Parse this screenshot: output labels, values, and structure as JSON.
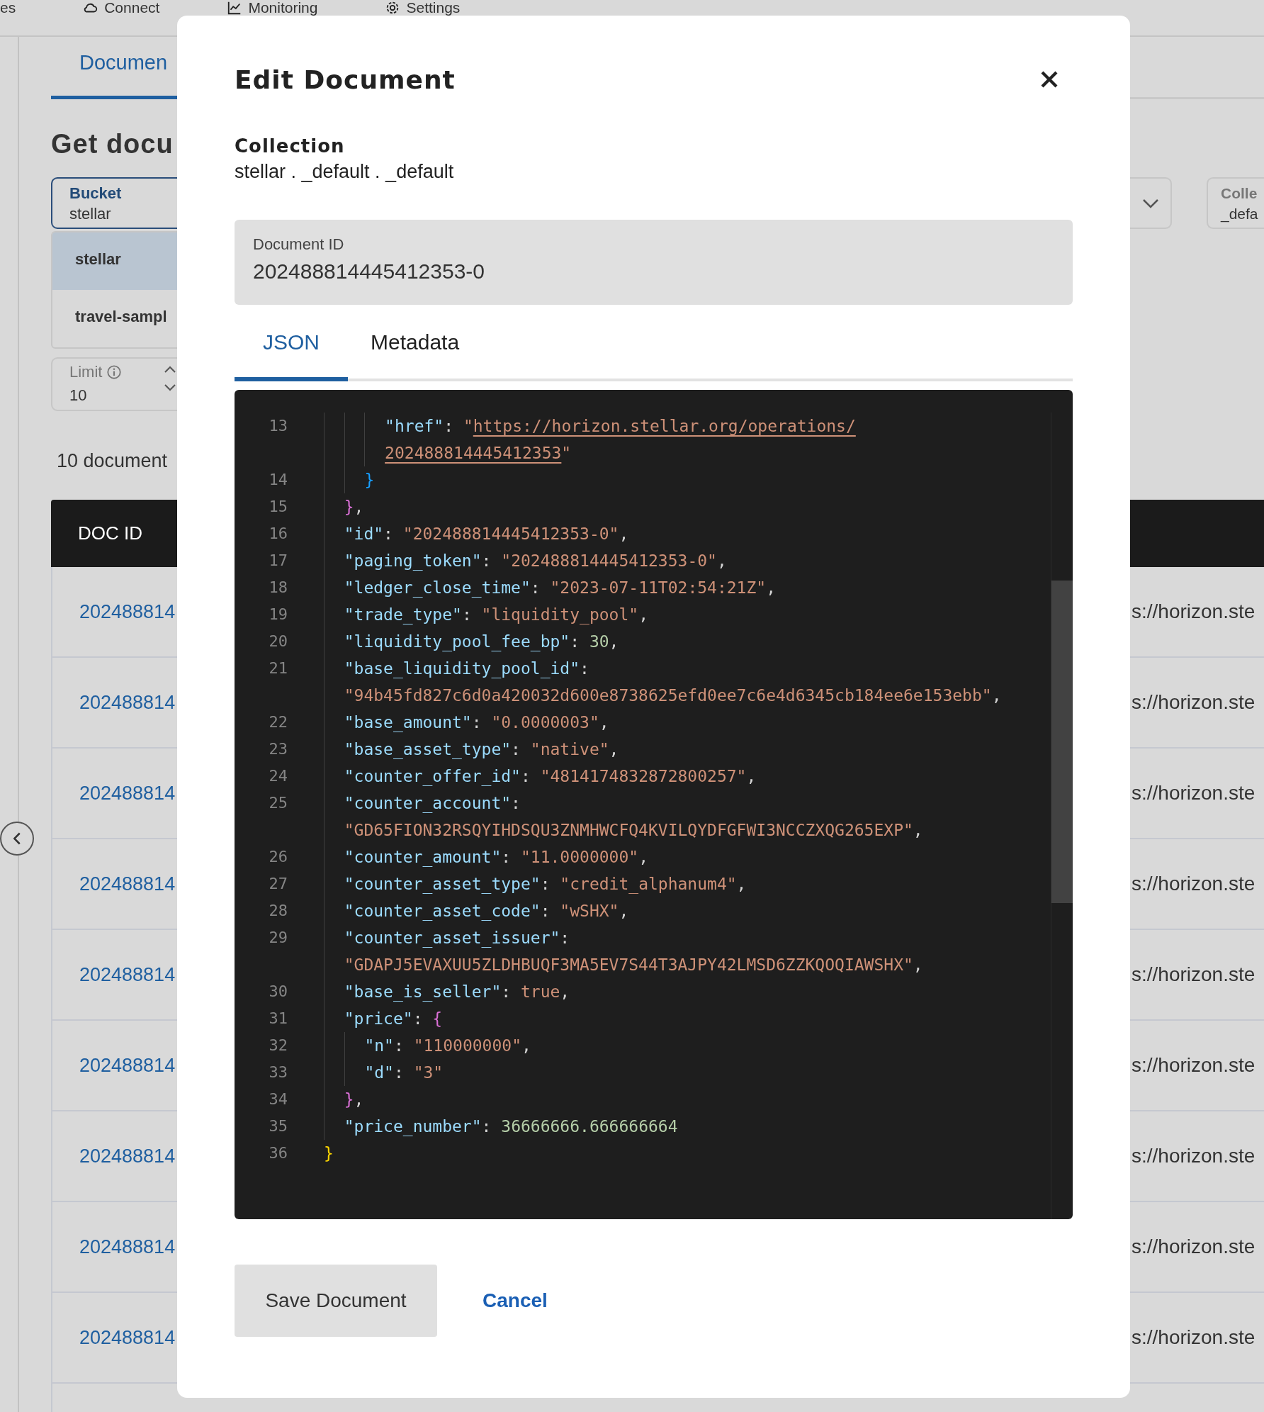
{
  "background": {
    "nav_items": [
      {
        "label": "es",
        "kind": "plain"
      },
      {
        "label": "Connect",
        "kind": "connect"
      },
      {
        "label": "Monitoring",
        "kind": "monitoring"
      },
      {
        "label": "Settings",
        "kind": "settings"
      }
    ],
    "tab": {
      "label": "Documen",
      "selected": true
    },
    "heading": "Get docu",
    "bucket_field": {
      "label": "Bucket",
      "value": "stellar"
    },
    "bucket_options": [
      {
        "label": "stellar",
        "selected": true
      },
      {
        "label": "travel-sampl",
        "selected": false
      }
    ],
    "limit_field": {
      "label": "Limit",
      "value": "10"
    },
    "collection_field": {
      "label": "Colle",
      "value": "_defa"
    },
    "result_count": "10 document",
    "table": {
      "columns": [
        "DOC ID"
      ],
      "rows": [
        {
          "doc_id": "202488814",
          "column_2": "s://horizon.ste"
        },
        {
          "doc_id": "202488814",
          "column_2": "s://horizon.ste"
        },
        {
          "doc_id": "202488814",
          "column_2": "s://horizon.ste"
        },
        {
          "doc_id": "202488814",
          "column_2": "s://horizon.ste"
        },
        {
          "doc_id": "202488814",
          "column_2": "s://horizon.ste"
        },
        {
          "doc_id": "202488814",
          "column_2": "s://horizon.ste"
        },
        {
          "doc_id": "202488814",
          "column_2": "s://horizon.ste"
        },
        {
          "doc_id": "202488814",
          "column_2": "s://horizon.ste"
        },
        {
          "doc_id": "202488814",
          "column_2": "s://horizon.ste"
        }
      ]
    }
  },
  "modal": {
    "title": "Edit Document",
    "collection_label": "Collection",
    "collection_path": "stellar . _default . _default",
    "document_id": {
      "label": "Document ID",
      "value": "202488814445412353-0"
    },
    "tabs": [
      {
        "label": "JSON",
        "selected": true
      },
      {
        "label": "Metadata",
        "selected": false
      }
    ],
    "code_rows": [
      {
        "number": "13",
        "tokens": [
          {
            "kind": "key",
            "text": "      \"href\""
          },
          {
            "kind": "punct",
            "text": ": "
          },
          {
            "kind": "string",
            "text": "\""
          },
          {
            "kind": "link",
            "text": "https://horizon.stellar.org/operations/"
          }
        ]
      },
      {
        "tokens": [
          {
            "kind": "link",
            "text": "      202488814445412353"
          },
          {
            "kind": "string",
            "text": "\""
          }
        ]
      },
      {
        "number": "14",
        "tokens": [
          {
            "kind": "brace-l3",
            "text": "    }"
          }
        ]
      },
      {
        "number": "15",
        "tokens": [
          {
            "kind": "brace-l2",
            "text": "  }"
          },
          {
            "kind": "punct",
            "text": ","
          }
        ]
      },
      {
        "number": "16",
        "tokens": [
          {
            "kind": "key",
            "text": "  \"id\""
          },
          {
            "kind": "punct",
            "text": ": "
          },
          {
            "kind": "string",
            "text": "\"202488814445412353-0\""
          },
          {
            "kind": "punct",
            "text": ","
          }
        ]
      },
      {
        "number": "17",
        "tokens": [
          {
            "kind": "key",
            "text": "  \"paging_token\""
          },
          {
            "kind": "punct",
            "text": ": "
          },
          {
            "kind": "string",
            "text": "\"202488814445412353-0\""
          },
          {
            "kind": "punct",
            "text": ","
          }
        ]
      },
      {
        "number": "18",
        "tokens": [
          {
            "kind": "key",
            "text": "  \"ledger_close_time\""
          },
          {
            "kind": "punct",
            "text": ": "
          },
          {
            "kind": "string",
            "text": "\"2023-07-11T02:54:21Z\""
          },
          {
            "kind": "punct",
            "text": ","
          }
        ]
      },
      {
        "number": "19",
        "tokens": [
          {
            "kind": "key",
            "text": "  \"trade_type\""
          },
          {
            "kind": "punct",
            "text": ": "
          },
          {
            "kind": "string",
            "text": "\"liquidity_pool\""
          },
          {
            "kind": "punct",
            "text": ","
          }
        ]
      },
      {
        "number": "20",
        "tokens": [
          {
            "kind": "key",
            "text": "  \"liquidity_pool_fee_bp\""
          },
          {
            "kind": "punct",
            "text": ": "
          },
          {
            "kind": "number",
            "text": "30"
          },
          {
            "kind": "punct",
            "text": ","
          }
        ]
      },
      {
        "number": "21",
        "tokens": [
          {
            "kind": "key",
            "text": "  \"base_liquidity_pool_id\""
          },
          {
            "kind": "punct",
            "text": ":"
          }
        ]
      },
      {
        "tokens": [
          {
            "kind": "string",
            "text": "  \"94b45fd827c6d0a420032d600e8738625efd0ee7c6e4d6345cb184ee6e153ebb\""
          },
          {
            "kind": "punct",
            "text": ","
          }
        ]
      },
      {
        "number": "22",
        "tokens": [
          {
            "kind": "key",
            "text": "  \"base_amount\""
          },
          {
            "kind": "punct",
            "text": ": "
          },
          {
            "kind": "string",
            "text": "\"0.0000003\""
          },
          {
            "kind": "punct",
            "text": ","
          }
        ]
      },
      {
        "number": "23",
        "tokens": [
          {
            "kind": "key",
            "text": "  \"base_asset_type\""
          },
          {
            "kind": "punct",
            "text": ": "
          },
          {
            "kind": "string",
            "text": "\"native\""
          },
          {
            "kind": "punct",
            "text": ","
          }
        ]
      },
      {
        "number": "24",
        "tokens": [
          {
            "kind": "key",
            "text": "  \"counter_offer_id\""
          },
          {
            "kind": "punct",
            "text": ": "
          },
          {
            "kind": "string",
            "text": "\"4814174832872800257\""
          },
          {
            "kind": "punct",
            "text": ","
          }
        ]
      },
      {
        "number": "25",
        "tokens": [
          {
            "kind": "key",
            "text": "  \"counter_account\""
          },
          {
            "kind": "punct",
            "text": ":"
          }
        ]
      },
      {
        "tokens": [
          {
            "kind": "string",
            "text": "  \"GD65FION32RSQYIHDSQU3ZNMHWCFQ4KVILQYDFGFWI3NCCZXQG265EXP\""
          },
          {
            "kind": "punct",
            "text": ","
          }
        ]
      },
      {
        "number": "26",
        "tokens": [
          {
            "kind": "key",
            "text": "  \"counter_amount\""
          },
          {
            "kind": "punct",
            "text": ": "
          },
          {
            "kind": "string",
            "text": "\"11.0000000\""
          },
          {
            "kind": "punct",
            "text": ","
          }
        ]
      },
      {
        "number": "27",
        "tokens": [
          {
            "kind": "key",
            "text": "  \"counter_asset_type\""
          },
          {
            "kind": "punct",
            "text": ": "
          },
          {
            "kind": "string",
            "text": "\"credit_alphanum4\""
          },
          {
            "kind": "punct",
            "text": ","
          }
        ]
      },
      {
        "number": "28",
        "tokens": [
          {
            "kind": "key",
            "text": "  \"counter_asset_code\""
          },
          {
            "kind": "punct",
            "text": ": "
          },
          {
            "kind": "string",
            "text": "\"wSHX\""
          },
          {
            "kind": "punct",
            "text": ","
          }
        ]
      },
      {
        "number": "29",
        "tokens": [
          {
            "kind": "key",
            "text": "  \"counter_asset_issuer\""
          },
          {
            "kind": "punct",
            "text": ":"
          }
        ]
      },
      {
        "tokens": [
          {
            "kind": "string",
            "text": "  \"GDAPJ5EVAXUU5ZLDHBUQF3MA5EV7S44T3AJPY42LMSD6ZZKQOQIAWSHX\""
          },
          {
            "kind": "punct",
            "text": ","
          }
        ]
      },
      {
        "number": "30",
        "tokens": [
          {
            "kind": "key",
            "text": "  \"base_is_seller\""
          },
          {
            "kind": "punct",
            "text": ": "
          },
          {
            "kind": "bool",
            "text": "true"
          },
          {
            "kind": "punct",
            "text": ","
          }
        ]
      },
      {
        "number": "31",
        "tokens": [
          {
            "kind": "key",
            "text": "  \"price\""
          },
          {
            "kind": "punct",
            "text": ": "
          },
          {
            "kind": "brace-l2",
            "text": "{"
          }
        ]
      },
      {
        "number": "32",
        "tokens": [
          {
            "kind": "key",
            "text": "    \"n\""
          },
          {
            "kind": "punct",
            "text": ": "
          },
          {
            "kind": "string",
            "text": "\"110000000\""
          },
          {
            "kind": "punct",
            "text": ","
          }
        ]
      },
      {
        "number": "33",
        "tokens": [
          {
            "kind": "key",
            "text": "    \"d\""
          },
          {
            "kind": "punct",
            "text": ": "
          },
          {
            "kind": "string",
            "text": "\"3\""
          }
        ]
      },
      {
        "number": "34",
        "tokens": [
          {
            "kind": "brace-l2",
            "text": "  }"
          },
          {
            "kind": "punct",
            "text": ","
          }
        ]
      },
      {
        "number": "35",
        "tokens": [
          {
            "kind": "key",
            "text": "  \"price_number\""
          },
          {
            "kind": "punct",
            "text": ": "
          },
          {
            "kind": "number",
            "text": "36666666.666666664"
          }
        ]
      },
      {
        "number": "36",
        "tokens": [
          {
            "kind": "brace-l1",
            "text": "}"
          }
        ]
      }
    ],
    "buttons": [
      {
        "label": "Save Document",
        "kind": "secondary"
      },
      {
        "label": "Cancel",
        "kind": "link"
      }
    ]
  }
}
